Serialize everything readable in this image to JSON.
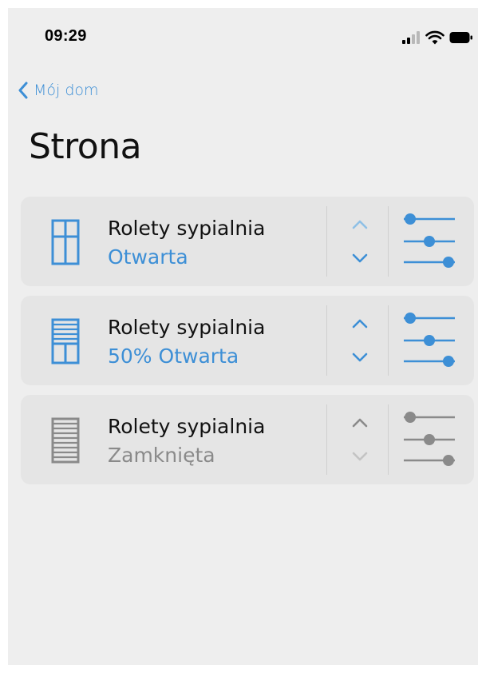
{
  "status_bar": {
    "time": "09:29"
  },
  "nav": {
    "back_label": "Mój dom",
    "title": "Strona"
  },
  "colors": {
    "accent": "#3d8fd6",
    "accent_light": "#8fc0e6",
    "inactive": "#8a8a8a",
    "inactive_light": "#c4c4c4"
  },
  "devices": [
    {
      "name": "Rolety sypialnia",
      "status": "Otwarta",
      "state": "open",
      "open_fraction": 1.0
    },
    {
      "name": "Rolety sypialnia",
      "status": "50% Otwarta",
      "state": "half",
      "open_fraction": 0.5
    },
    {
      "name": "Rolety sypialnia",
      "status": "Zamknięta",
      "state": "closed",
      "open_fraction": 0.0
    }
  ],
  "icons": {
    "back": "chevron-left-icon",
    "up": "chevron-up-icon",
    "down": "chevron-down-icon",
    "settings": "sliders-icon",
    "signal": "cellular-signal-icon",
    "wifi": "wifi-icon",
    "battery": "battery-icon"
  }
}
